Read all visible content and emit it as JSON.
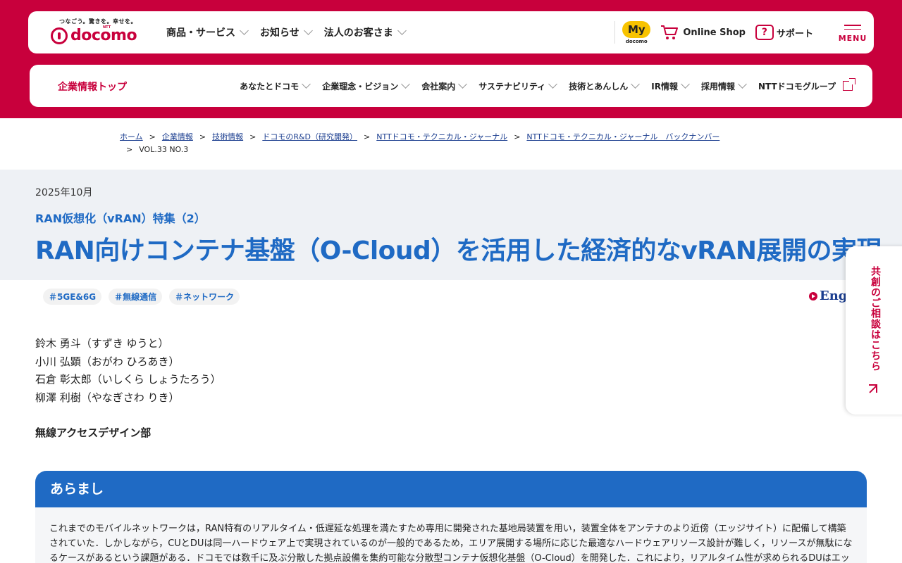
{
  "header": {
    "tagline": "つなごう。驚きを。幸せを。",
    "logo_ntt": "NTT",
    "logo_text": "docomo",
    "nav": [
      "商品・サービス",
      "お知らせ",
      "法人のお客さま"
    ],
    "my_badge": "My",
    "my_sub": "docomo",
    "online_shop": "Online Shop",
    "support_icon": "?",
    "support": "サポート",
    "menu": "MENU"
  },
  "corp_nav": {
    "top": "企業情報トップ",
    "items": [
      "あなたとドコモ",
      "企業理念・ビジョン",
      "会社案内",
      "サステナビリティ",
      "技術とあんしん",
      "IR情報",
      "採用情報"
    ],
    "group": "NTTドコモグループ"
  },
  "breadcrumb": {
    "links": [
      "ホーム",
      "企業情報",
      "技術情報",
      "ドコモのR&D（研究開発）",
      "NTTドコモ・テクニカル・ジャーナル",
      "NTTドコモ・テクニカル・ジャーナル　バックナンバー"
    ],
    "current": "VOL.33 NO.3",
    "separator": ">"
  },
  "article": {
    "date": "2025年10月",
    "feature": "RAN仮想化（vRAN）特集（2）",
    "title": "RAN向けコンテナ基盤（O-Cloud）を活用した経済的なvRAN展開の実現",
    "tags": [
      "＃5GE&6G",
      "＃無線通信",
      "＃ネットワーク"
    ],
    "english_link": "English",
    "authors": [
      "鈴木 勇斗（すずき ゆうと）",
      "小川 弘顕（おがわ ひろあき）",
      "石倉 彰太郎（いしくら しょうたろう）",
      "柳澤 利樹（やなぎさわ りき）"
    ],
    "department": "無線アクセスデザイン部"
  },
  "summary": {
    "heading": "あらまし",
    "text": "これまでのモバイルネットワークは，RAN特有のリアルタイム・低遅延な処理を満たすため専用に開発された基地局装置を用い，装置全体をアンテナのより近傍（エッジサイト）に配備して構築されていた．しかしながら，CUとDUは同一ハードウェア上で実現されているのが一般的であるため，エリア展開する場所に応じた最適なハードウェアリソース設計が難しく，リソースが無駄になるケースがあるという課題がある．ドコモでは数千に及ぶ分散した拠点設備を集約可能な分散型コンテナ仮想化基盤（O-Cloud）を開発した．これにより，リアルタイム性が求められるDUはエッ"
  },
  "consult": {
    "label": "共創のご相談はこちら"
  },
  "colors": {
    "brand_red": "#c8003c",
    "accent_blue": "#1f6ac4",
    "title_bg": "#eef1f5"
  }
}
